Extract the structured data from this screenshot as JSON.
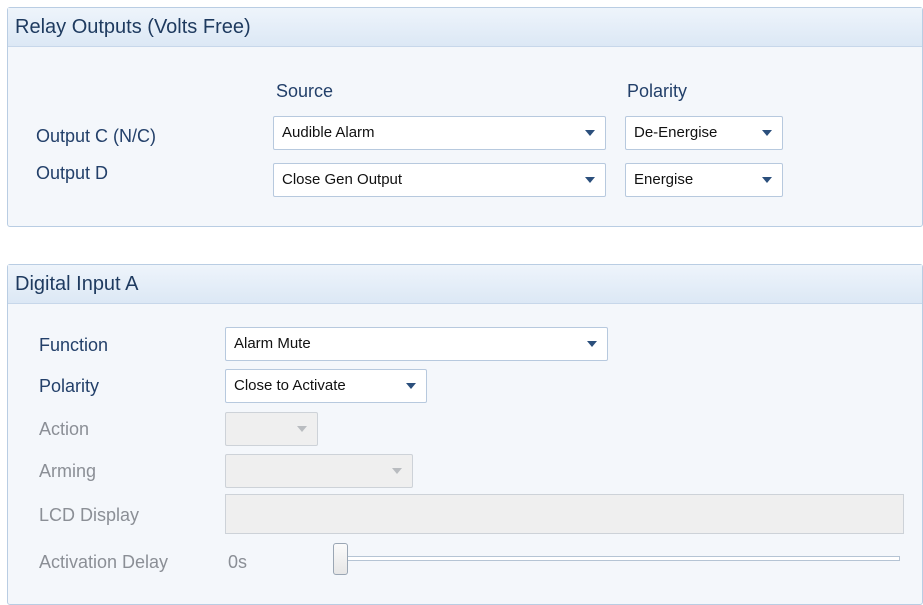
{
  "relay_outputs": {
    "title": "Relay Outputs (Volts Free)",
    "source_header": "Source",
    "polarity_header": "Polarity",
    "rows": [
      {
        "label": "Output C (N/C)",
        "source": "Audible Alarm",
        "polarity": "De-Energise"
      },
      {
        "label": "Output D",
        "source": "Close Gen Output",
        "polarity": "Energise"
      }
    ]
  },
  "digital_input": {
    "title": "Digital Input A",
    "function_label": "Function",
    "function_value": "Alarm Mute",
    "polarity_label": "Polarity",
    "polarity_value": "Close to Activate",
    "action_label": "Action",
    "action_value": "",
    "arming_label": "Arming",
    "arming_value": "",
    "lcd_label": "LCD Display",
    "lcd_value": "",
    "delay_label": "Activation Delay",
    "delay_value": "0s",
    "delay_slider_fraction": 0
  },
  "colors": {
    "panel_border": "#b9cde3",
    "header_bg": "#dce8f5",
    "label_text": "#23406a",
    "disabled_text": "#8b8f96"
  }
}
